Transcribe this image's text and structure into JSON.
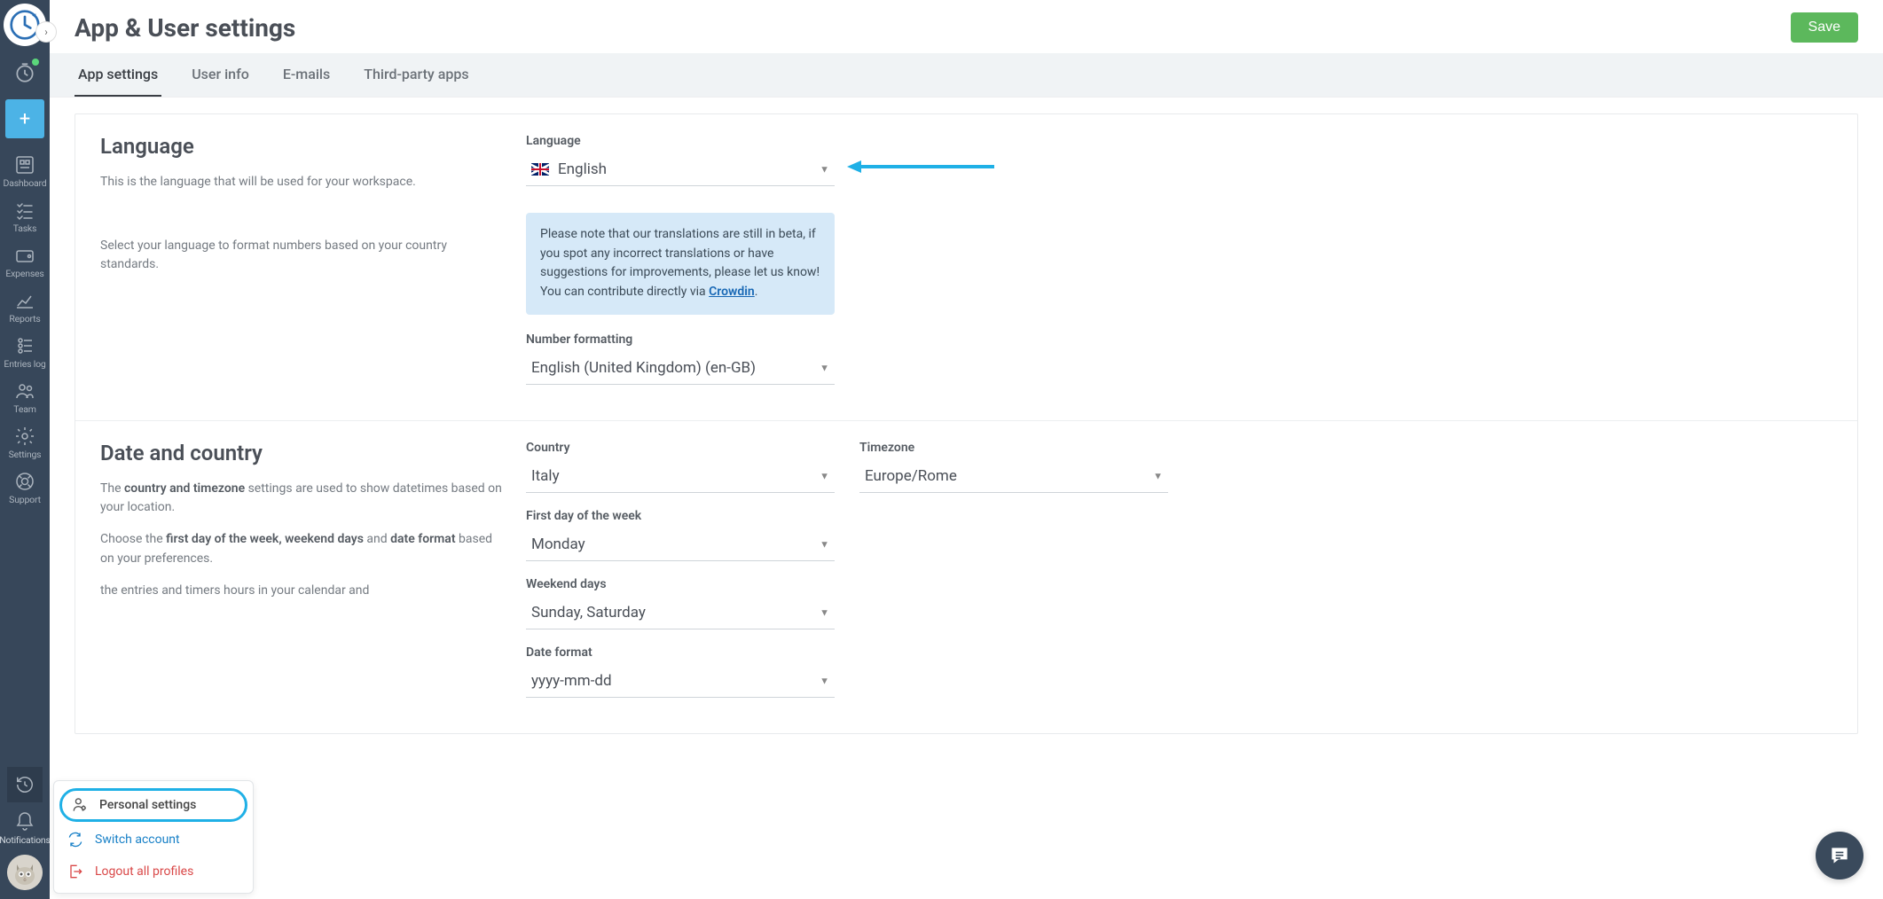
{
  "sidebar": {
    "timer_dot_color": "#5bd67b",
    "nav": [
      {
        "label": "Dashboard"
      },
      {
        "label": "Tasks"
      },
      {
        "label": "Expenses"
      },
      {
        "label": "Reports"
      },
      {
        "label": "Entries log"
      },
      {
        "label": "Team"
      },
      {
        "label": "Settings"
      },
      {
        "label": "Support"
      }
    ],
    "notifications_label": "Notifications"
  },
  "popup": {
    "items": [
      {
        "label": "Personal settings",
        "kind": "active"
      },
      {
        "label": "Switch account",
        "kind": "link"
      },
      {
        "label": "Logout all profiles",
        "kind": "danger"
      }
    ]
  },
  "header": {
    "title": "App & User settings",
    "save_label": "Save"
  },
  "tabs": [
    {
      "label": "App settings",
      "active": true
    },
    {
      "label": "User info"
    },
    {
      "label": "E-mails"
    },
    {
      "label": "Third-party apps"
    }
  ],
  "language_section": {
    "heading": "Language",
    "desc1": "This is the language that will be used for your workspace.",
    "desc2": "Select your language to format numbers based on your country standards.",
    "language_label": "Language",
    "language_value": "English",
    "note_text": "Please note that our translations are still in beta, if you spot any incorrect translations or have suggestions for improvements, please let us know! You can contribute directly via ",
    "note_link": "Crowdin",
    "number_label": "Number formatting",
    "number_value": "English (United Kingdom) (en-GB)"
  },
  "date_section": {
    "heading": "Date and country",
    "desc1_pre": "The ",
    "desc1_bold": "country and timezone",
    "desc1_post": " settings are used to show datetimes based on your location.",
    "desc2_pre": "Choose the ",
    "desc2_bold": "first day of the week, weekend days",
    "desc2_mid": " and ",
    "desc2_bold2": "date format",
    "desc2_post": " based on your preferences.",
    "desc3": "the entries and timers hours in your calendar and",
    "country_label": "Country",
    "country_value": "Italy",
    "timezone_label": "Timezone",
    "timezone_value": "Europe/Rome",
    "firstday_label": "First day of the week",
    "firstday_value": "Monday",
    "weekend_label": "Weekend days",
    "weekend_value": "Sunday, Saturday",
    "dateformat_label": "Date format",
    "dateformat_value": "yyyy-mm-dd"
  },
  "arrow_color": "#1fb0e6"
}
